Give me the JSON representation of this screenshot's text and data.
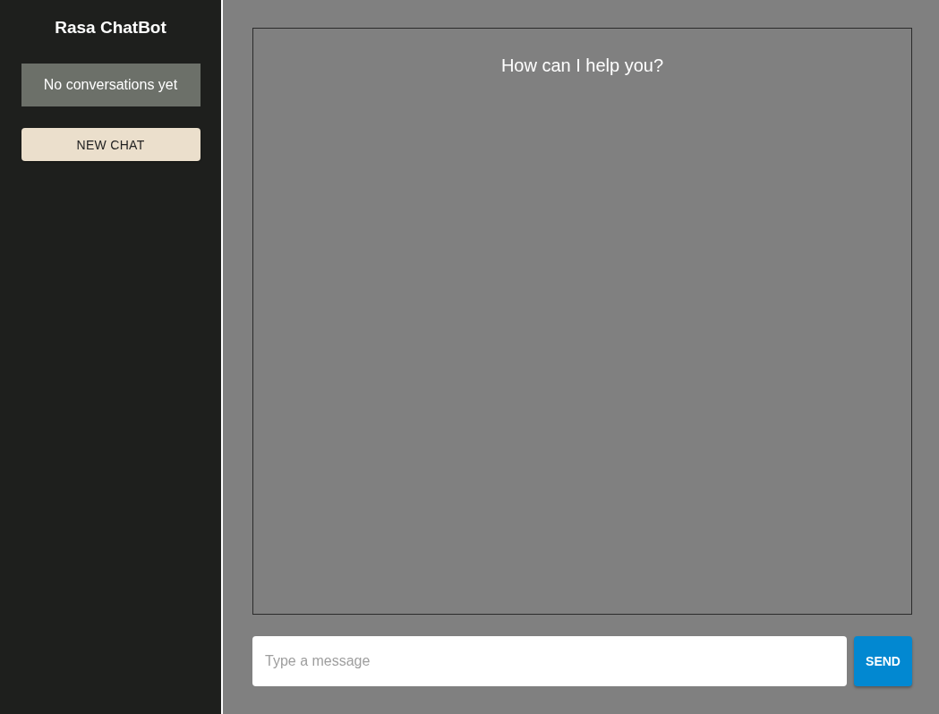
{
  "sidebar": {
    "title": "Rasa ChatBot",
    "empty_message": "No conversations yet",
    "new_chat_button": "NEW CHAT"
  },
  "chat": {
    "greeting": "How can I help you?"
  },
  "composer": {
    "placeholder": "Type a message",
    "send_button": "SEND"
  }
}
